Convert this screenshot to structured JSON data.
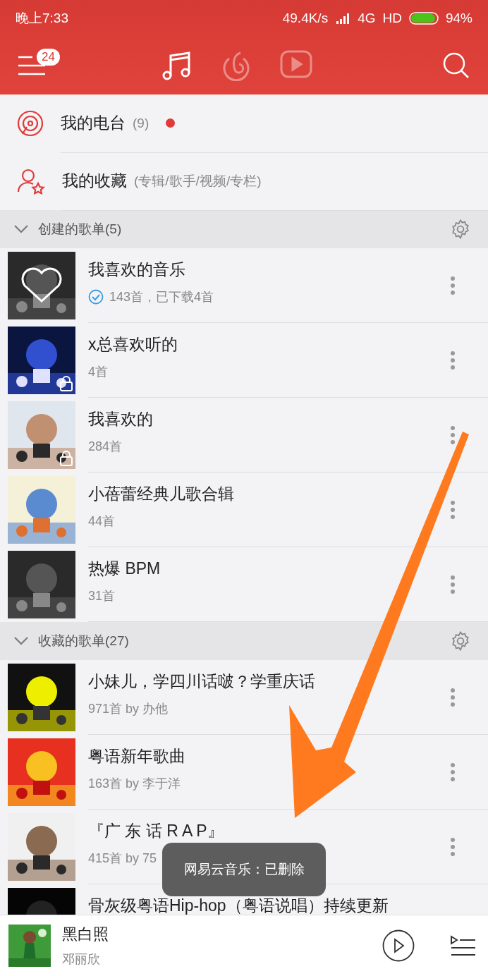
{
  "status_bar": {
    "time": "晚上7:33",
    "speed": "49.4K/s",
    "network": "4G",
    "hd": "HD",
    "battery": "94%"
  },
  "toolbar": {
    "badge": "24",
    "tabs": [
      {
        "kind": "music",
        "selected": true
      },
      {
        "kind": "radio",
        "selected": false
      },
      {
        "kind": "video",
        "selected": false
      }
    ]
  },
  "menu": [
    {
      "kind": "radio",
      "label": "我的电台",
      "note": "(9)",
      "new": true
    },
    {
      "kind": "collect",
      "label": "我的收藏",
      "note": "(专辑/歌手/视频/专栏)",
      "new": false
    }
  ],
  "sections": [
    {
      "title": "创建的歌单(5)",
      "expanded": true,
      "playlists": [
        {
          "title": "我喜欢的音乐",
          "sub": "143首，已下载4首",
          "downloaded": true,
          "locked": false,
          "heart": true
        },
        {
          "title": "x总喜欢听的",
          "sub": "4首",
          "downloaded": false,
          "locked": true,
          "heart": false
        },
        {
          "title": "我喜欢的",
          "sub": "284首",
          "downloaded": false,
          "locked": true,
          "heart": false
        },
        {
          "title": "小蓓蕾经典儿歌合辑",
          "sub": "44首",
          "downloaded": false,
          "locked": false,
          "heart": false
        },
        {
          "title": "热爆 BPM",
          "sub": "31首",
          "downloaded": false,
          "locked": false,
          "heart": false
        }
      ]
    },
    {
      "title": "收藏的歌单(27)",
      "expanded": true,
      "playlists": [
        {
          "title": "小妹儿，学四川话啵？学重庆话",
          "sub": "971首 by 办他",
          "downloaded": false,
          "locked": false,
          "heart": false
        },
        {
          "title": "粤语新年歌曲",
          "sub": "163首 by 李于洋",
          "downloaded": false,
          "locked": false,
          "heart": false
        },
        {
          "title": "『广 东 话 R A P』",
          "sub": "415首 by 75",
          "downloaded": false,
          "locked": false,
          "heart": false
        },
        {
          "title": "骨灰级粤语Hip-hop（粤语说唱）持续更新",
          "downloaded": false,
          "locked": false,
          "heart": false
        }
      ]
    }
  ],
  "toast": "网易云音乐：已删除",
  "player": {
    "song": "黑白照",
    "artist": "邓丽欣"
  }
}
